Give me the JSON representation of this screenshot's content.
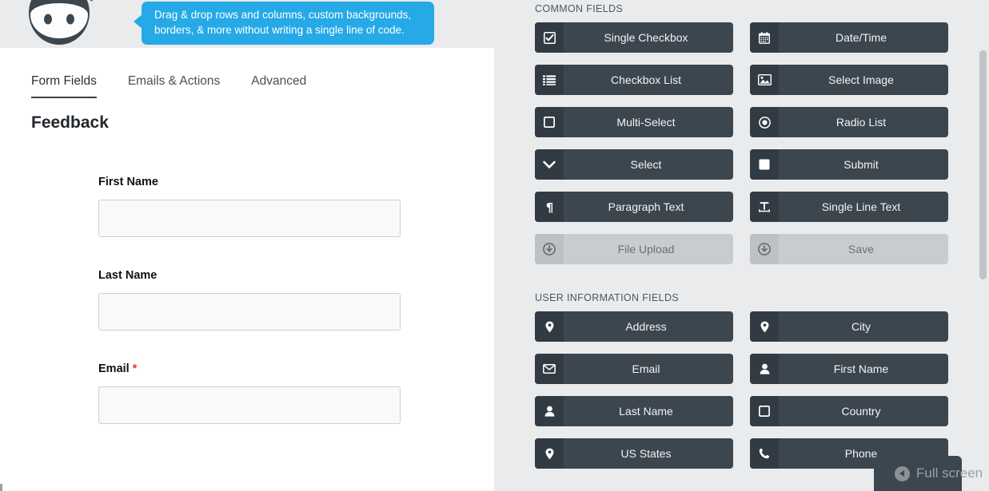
{
  "callout": {
    "line1": "Drag & drop rows and columns, custom backgrounds,",
    "line2": "borders, & more without writing a single line of code."
  },
  "logo": {
    "name": "ninja-forms-logo"
  },
  "tabs": [
    {
      "label": "Form Fields",
      "active": true
    },
    {
      "label": "Emails & Actions",
      "active": false
    },
    {
      "label": "Advanced",
      "active": false
    }
  ],
  "form": {
    "title": "Feedback",
    "fields": [
      {
        "label": "First Name",
        "required": false,
        "value": "",
        "placeholder": ""
      },
      {
        "label": "Last Name",
        "required": false,
        "value": "",
        "placeholder": ""
      },
      {
        "label": "Email",
        "required": true,
        "value": "",
        "placeholder": ""
      }
    ],
    "required_marker": "*"
  },
  "palette": {
    "sections": [
      {
        "heading": "COMMON FIELDS",
        "buttons": [
          {
            "label": "Single Checkbox",
            "icon": "checkbox-checked-icon",
            "disabled": false
          },
          {
            "label": "Date/Time",
            "icon": "calendar-icon",
            "disabled": false
          },
          {
            "label": "Checkbox List",
            "icon": "list-icon",
            "disabled": false
          },
          {
            "label": "Select Image",
            "icon": "image-icon",
            "disabled": false
          },
          {
            "label": "Multi-Select",
            "icon": "square-outline-icon",
            "disabled": false
          },
          {
            "label": "Radio List",
            "icon": "radio-button-icon",
            "disabled": false
          },
          {
            "label": "Select",
            "icon": "chevron-down-icon",
            "disabled": false
          },
          {
            "label": "Submit",
            "icon": "square-filled-icon",
            "disabled": false
          },
          {
            "label": "Paragraph Text",
            "icon": "pilcrow-icon",
            "disabled": false
          },
          {
            "label": "Single Line Text",
            "icon": "text-width-icon",
            "disabled": false
          },
          {
            "label": "File Upload",
            "icon": "download-circle-icon",
            "disabled": true
          },
          {
            "label": "Save",
            "icon": "download-circle-icon",
            "disabled": true
          }
        ]
      },
      {
        "heading": "USER INFORMATION FIELDS",
        "buttons": [
          {
            "label": "Address",
            "icon": "map-pin-icon",
            "disabled": false
          },
          {
            "label": "City",
            "icon": "map-pin-icon",
            "disabled": false
          },
          {
            "label": "Email",
            "icon": "envelope-icon",
            "disabled": false
          },
          {
            "label": "First Name",
            "icon": "user-icon",
            "disabled": false
          },
          {
            "label": "Last Name",
            "icon": "user-icon",
            "disabled": false
          },
          {
            "label": "Country",
            "icon": "square-outline-icon",
            "disabled": false
          },
          {
            "label": "US States",
            "icon": "map-pin-icon",
            "disabled": false
          },
          {
            "label": "Phone",
            "icon": "phone-icon",
            "disabled": false
          }
        ]
      }
    ]
  },
  "fullscreen": {
    "label": "Full screen",
    "icon": "back-arrow-circle-icon"
  },
  "colors": {
    "accent_blue": "#25a9e7",
    "button_dark": "#3c464f",
    "button_icon_dark": "#323b43",
    "button_disabled": "#c9cccf",
    "page_bg": "#eaebec",
    "required_red": "#e53333"
  }
}
